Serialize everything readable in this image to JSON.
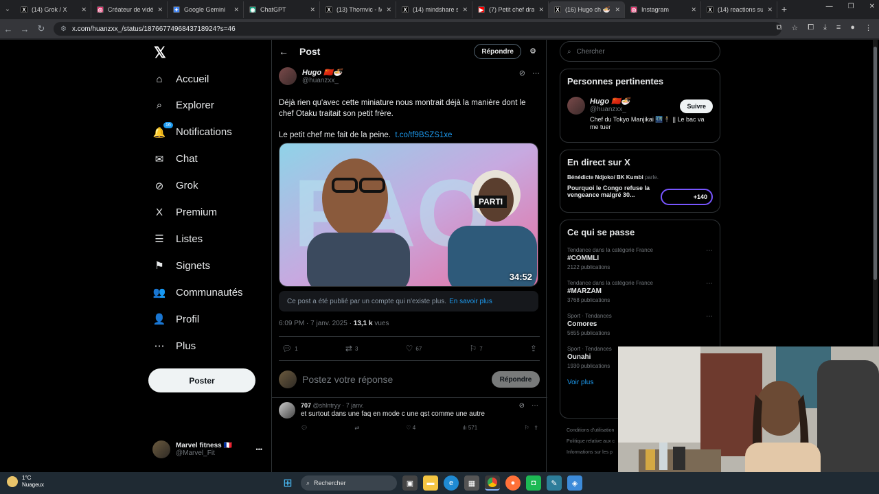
{
  "browser": {
    "tabs": [
      {
        "title": "(14) Grok / X",
        "fav": "X",
        "color": "#000000"
      },
      {
        "title": "Créateur de vidéo",
        "fav": "◎",
        "color": "#e1306c"
      },
      {
        "title": "Google Gemini",
        "fav": "✦",
        "color": "#4285f4"
      },
      {
        "title": "ChatGPT",
        "fav": "◉",
        "color": "#10a37f"
      },
      {
        "title": "(13) Thornvic - Mu",
        "fav": "X",
        "color": "#000000"
      },
      {
        "title": "(14) mindshare sur",
        "fav": "X",
        "color": "#000000"
      },
      {
        "title": "(7) Petit chef dran",
        "fav": "▶",
        "color": "#ff0000"
      },
      {
        "title": "(16) Hugo ch 🍜",
        "fav": "X",
        "color": "#000000"
      },
      {
        "title": "Instagram",
        "fav": "◎",
        "color": "#e1306c"
      },
      {
        "title": "(14) reactions sur",
        "fav": "X",
        "color": "#000000"
      }
    ],
    "url": "x.com/huanzxx_/status/1876677496843718924?s=46"
  },
  "nav": {
    "items": [
      {
        "label": "Accueil",
        "icon": "⌂"
      },
      {
        "label": "Explorer",
        "icon": "⌕"
      },
      {
        "label": "Notifications",
        "icon": "🔔",
        "badge": "16"
      },
      {
        "label": "Chat",
        "icon": "✉"
      },
      {
        "label": "Grok",
        "icon": "⊘"
      },
      {
        "label": "Premium",
        "icon": "X"
      },
      {
        "label": "Listes",
        "icon": "☰"
      },
      {
        "label": "Signets",
        "icon": "⚑"
      },
      {
        "label": "Communautés",
        "icon": "👥"
      },
      {
        "label": "Profil",
        "icon": "👤"
      },
      {
        "label": "Plus",
        "icon": "⋯"
      }
    ],
    "post_button": "Poster",
    "account": {
      "name": "Marvel fitness 🇫🇷",
      "handle": "@Marvel_Fit",
      "more": "•••"
    }
  },
  "header": {
    "title": "Post",
    "reply": "Répondre"
  },
  "post": {
    "author_name": "Hugo 🇨🇳🍜",
    "author_handle": "@huanzxx_",
    "text1": "Déjà rien qu'avec cette miniature nous montrait déjà la manière dont le chef Otaku traitait son petit frère.",
    "text2": "Le petit chef me fait de la peine.",
    "link": "t.co/tf9BSZS1xe",
    "video_duration": "34:52",
    "parti": "PARTI",
    "notice": "Ce post a été publié par un compte qui n'existe plus.",
    "notice_link": "En savoir plus",
    "time": "6:09 PM · 7 janv. 2025 · ",
    "views_count": "13,1 k",
    "views_label": " vues",
    "stats": {
      "replies": "1",
      "reposts": "3",
      "likes": "67",
      "bookmarks": "7"
    },
    "reply_placeholder": "Postez votre réponse",
    "reply_button": "Répondre"
  },
  "comment": {
    "name": "707",
    "handle": "@shlntryy · 7 janv.",
    "text": "et surtout dans une faq en mode c une qst comme une autre",
    "likes": "4",
    "views": "571"
  },
  "right": {
    "search_placeholder": "Chercher",
    "relevant_title": "Personnes pertinentes",
    "person": {
      "name": "Hugo 🇨🇳🍜",
      "handle": "@huanzxx_",
      "bio": "Chef du Tokyo Manjikai 🌃🕴 || Le bac va me tuer",
      "follow": "Suivre"
    },
    "live_title": "En direct sur X",
    "live": {
      "host": "Bénédicte Ndjoko/ BK Kumbi",
      "verb": "parle.",
      "title": "Pourquoi le Congo refuse la vengeance malgré 30...",
      "count": "+140"
    },
    "trends_title": "Ce qui se passe",
    "trends": [
      {
        "category": "Tendance dans la catégorie France",
        "name": "#COMMLI",
        "posts": "2122 publications"
      },
      {
        "category": "Tendance dans la catégorie France",
        "name": "#MARZAM",
        "posts": "3768 publications"
      },
      {
        "category": "Sport · Tendances",
        "name": "Comores",
        "posts": "5655 publications"
      },
      {
        "category": "Sport · Tendances",
        "name": "Ounahi",
        "posts": "1930 publications"
      }
    ],
    "see_more": "Voir plus",
    "footer": [
      "Conditions d'utilisation",
      "Politique relative aux c",
      "Informations sur les p"
    ]
  },
  "taskbar": {
    "temp": "1°C",
    "weather": "Nuageux",
    "search": "Rechercher"
  }
}
